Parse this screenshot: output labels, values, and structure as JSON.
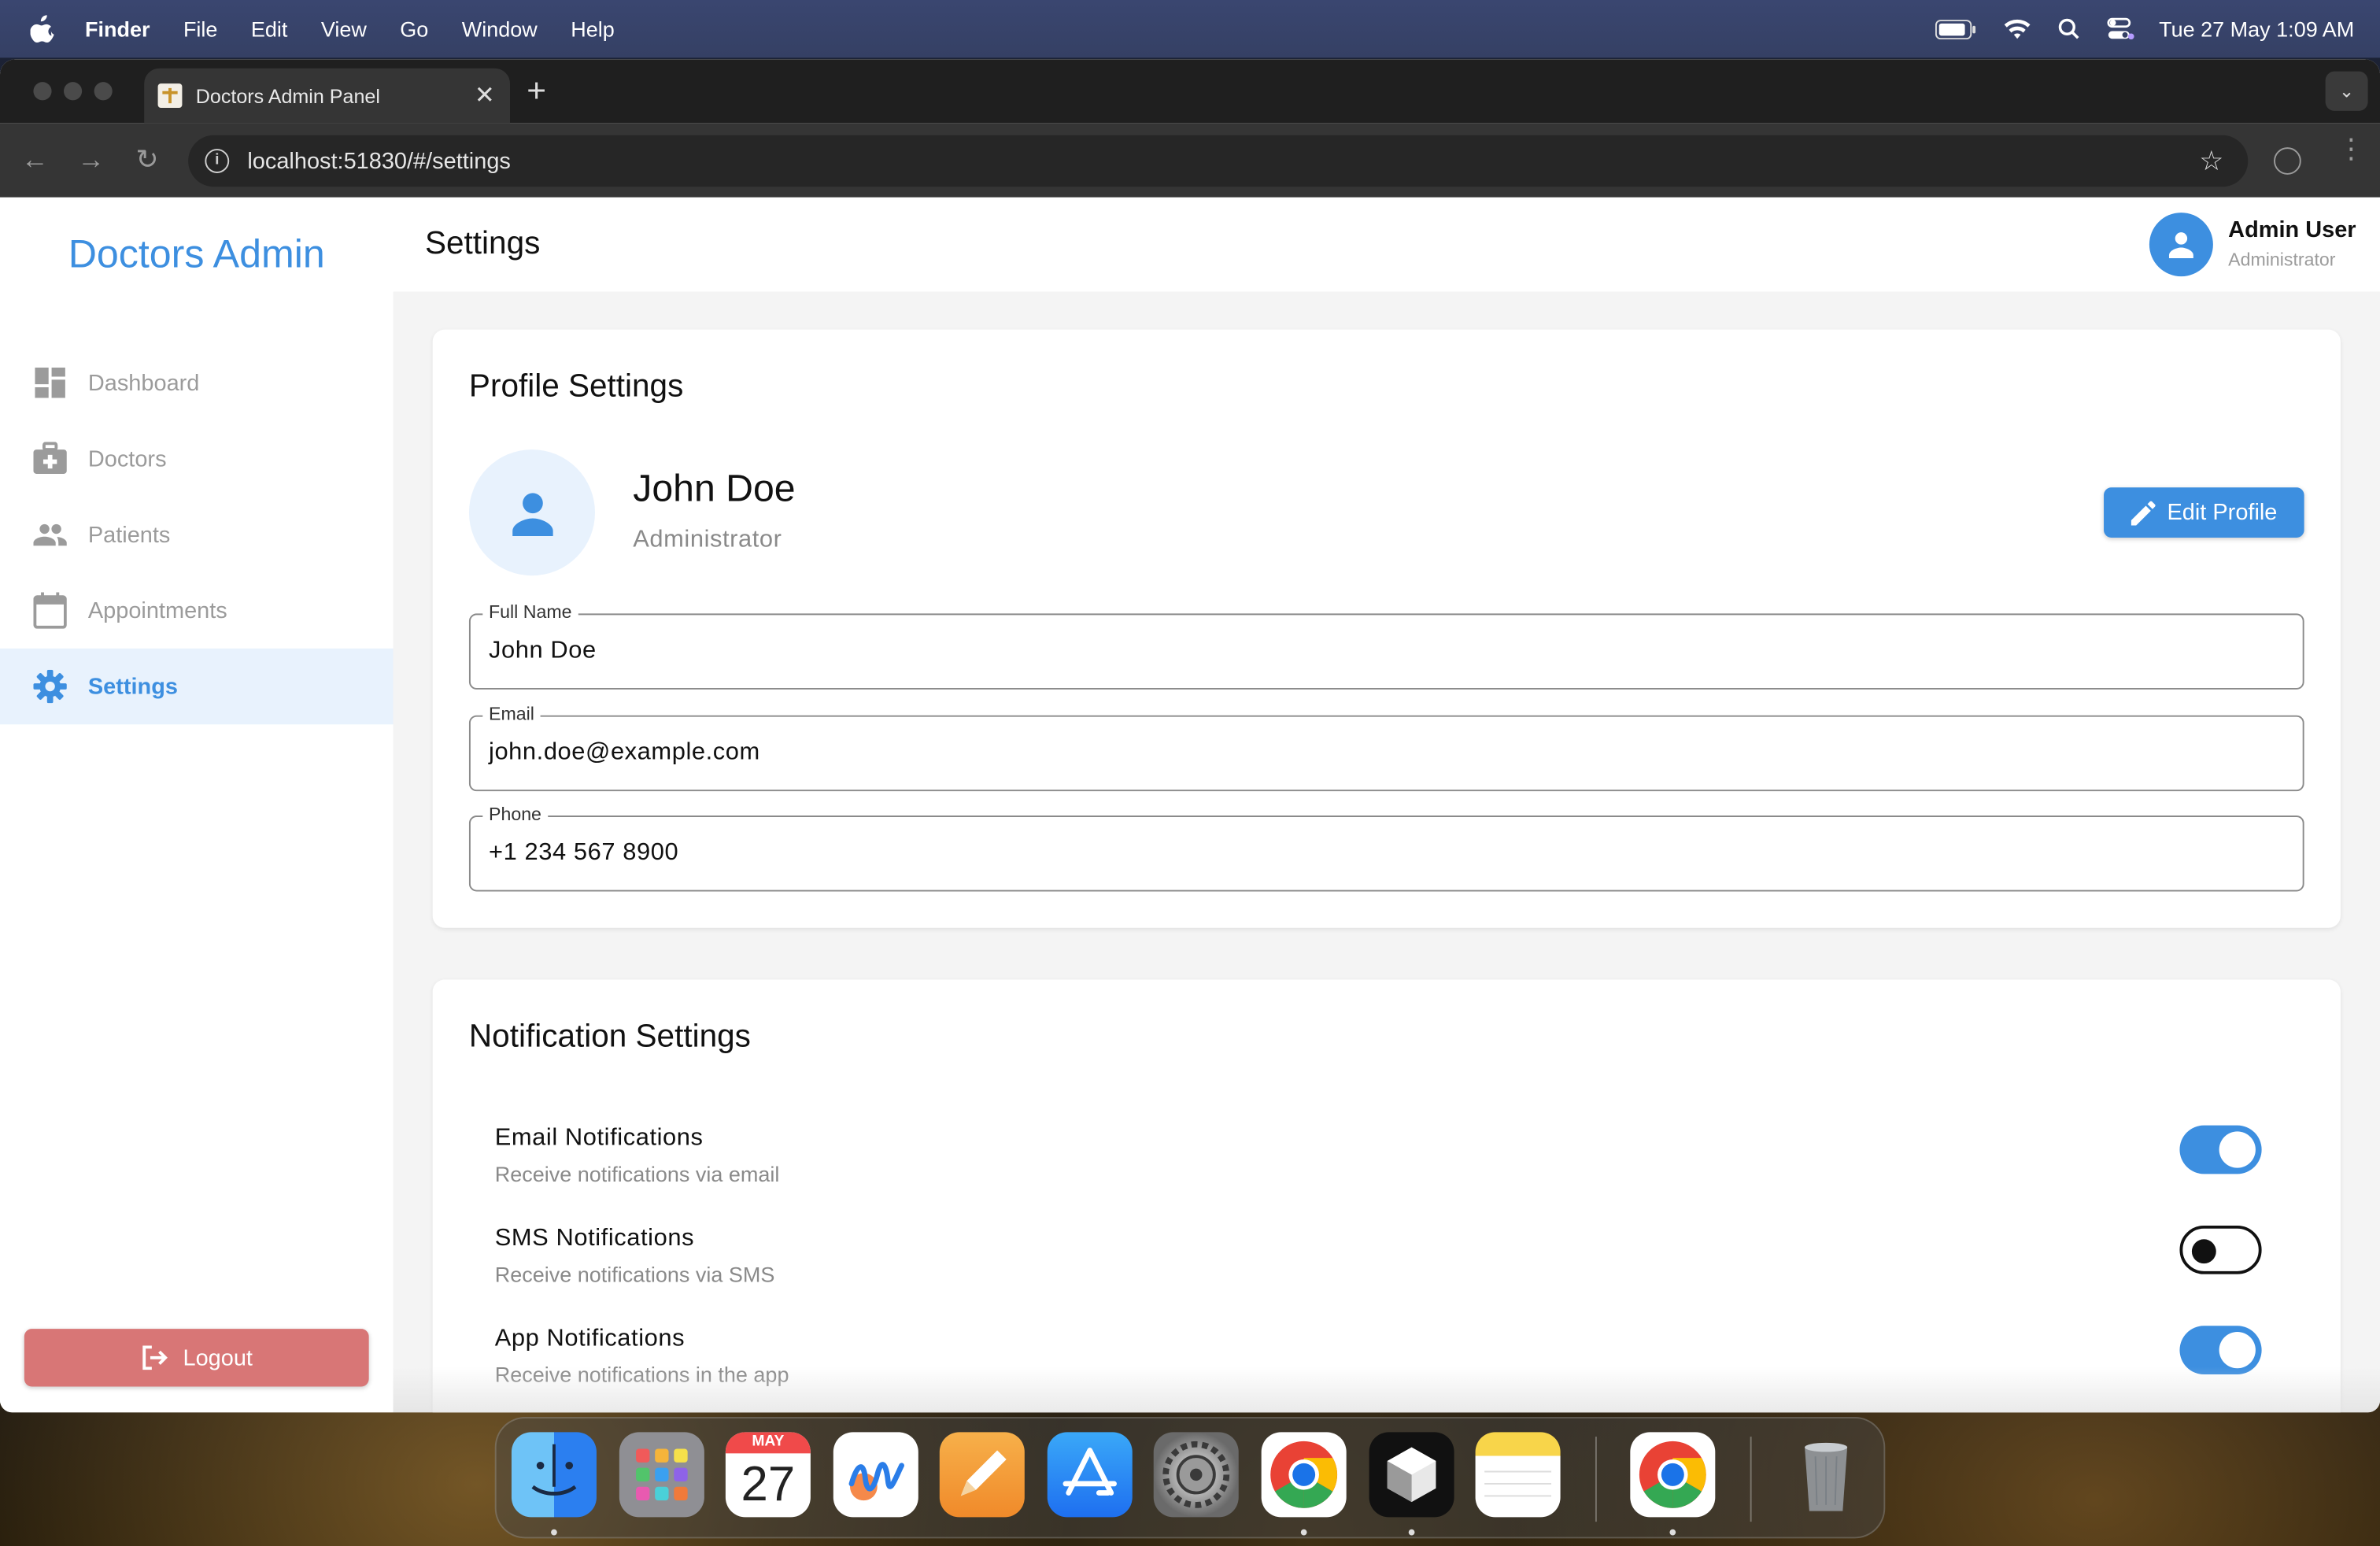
{
  "menubar": {
    "app_name": "Finder",
    "menus": [
      "File",
      "Edit",
      "View",
      "Go",
      "Window",
      "Help"
    ],
    "clock": "Tue 27 May  1:09 AM"
  },
  "browser": {
    "tab_title": "Doctors Admin Panel",
    "url": "localhost:51830/#/settings"
  },
  "sidebar": {
    "brand": "Doctors Admin",
    "items": [
      {
        "label": "Dashboard",
        "icon": "dashboard-icon"
      },
      {
        "label": "Doctors",
        "icon": "medical-bag-icon"
      },
      {
        "label": "Patients",
        "icon": "people-icon"
      },
      {
        "label": "Appointments",
        "icon": "calendar-icon"
      },
      {
        "label": "Settings",
        "icon": "gear-icon",
        "active": true
      }
    ],
    "logout_label": "Logout"
  },
  "header": {
    "title": "Settings",
    "user_name": "Admin User",
    "user_role": "Administrator"
  },
  "profile": {
    "section_title": "Profile Settings",
    "name": "John Doe",
    "role": "Administrator",
    "edit_label": "Edit Profile",
    "fields": [
      {
        "label": "Full Name",
        "value": "John Doe"
      },
      {
        "label": "Email",
        "value": "john.doe@example.com"
      },
      {
        "label": "Phone",
        "value": "+1 234 567 8900"
      }
    ]
  },
  "notifications": {
    "section_title": "Notification Settings",
    "items": [
      {
        "title": "Email Notifications",
        "subtitle": "Receive notifications via email",
        "enabled": true
      },
      {
        "title": "SMS Notifications",
        "subtitle": "Receive notifications via SMS",
        "enabled": false
      },
      {
        "title": "App Notifications",
        "subtitle": "Receive notifications in the app",
        "enabled": true
      }
    ]
  },
  "dock": {
    "calendar_month": "MAY",
    "calendar_day": "27",
    "apps": [
      "finder-icon",
      "launchpad-icon",
      "calendar-icon",
      "freeform-icon",
      "pages-icon",
      "app-store-icon",
      "system-settings-icon",
      "chrome-icon",
      "cube-app-icon",
      "notes-icon",
      "chrome-icon",
      "trash-icon"
    ]
  },
  "colors": {
    "accent": "#3d8fe0",
    "logout": "#d87676",
    "active_bg": "#e8f2fd"
  }
}
